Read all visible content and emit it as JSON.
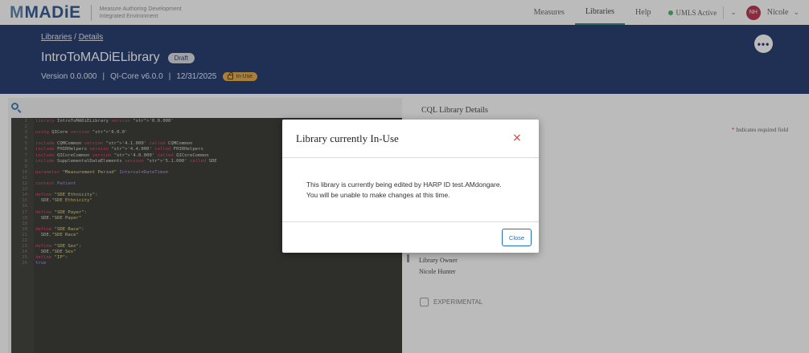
{
  "app": {
    "logo_mark": "M",
    "logo_text": "MADiE",
    "logo_sub_line1": "Measure Authoring Development",
    "logo_sub_line2": "Integrated Environment"
  },
  "nav": {
    "items": [
      "Measures",
      "Libraries",
      "Help"
    ],
    "active": "Libraries",
    "umls_status": "UMLS Active",
    "avatar_initials": "NH",
    "user_name": "Nicole"
  },
  "header": {
    "breadcrumb_root": "Libraries",
    "breadcrumb_separator": "/",
    "breadcrumb_current": "Details",
    "title": "IntroToMADiELibrary",
    "status_badge": "Draft",
    "version": "Version 0.0.000",
    "model": "QI-Core v6.0.0",
    "date": "12/31/2025",
    "meta_separator": "|",
    "in_use_badge": "In-Use",
    "more_button": "•••"
  },
  "editor": {
    "lines": [
      {
        "n": "1",
        "text": "library IntroToMADiELibrary version '0.0.000'"
      },
      {
        "n": "2",
        "text": ""
      },
      {
        "n": "3",
        "text": "using QICore version '6.0.0'"
      },
      {
        "n": "4",
        "text": ""
      },
      {
        "n": "5",
        "text": "include CQMCommon version '4.1.000' called CQMCommon"
      },
      {
        "n": "6",
        "text": "include FHIRHelpers version '4.4.000' called FHIRHelpers"
      },
      {
        "n": "7",
        "text": "include QICoreCommon version '4.0.000' called QICoreCommon"
      },
      {
        "n": "8",
        "text": "include SupplementalDataElements version '5.1.000' called SDE"
      },
      {
        "n": "9",
        "text": ""
      },
      {
        "n": "10",
        "text": "parameter \"Measurement Period\" Interval<DateTime>"
      },
      {
        "n": "11",
        "text": ""
      },
      {
        "n": "12",
        "text": "context Patient"
      },
      {
        "n": "13",
        "text": ""
      },
      {
        "n": "14",
        "text": "define \"SDE Ethnicity\":"
      },
      {
        "n": "15",
        "text": "  SDE.\"SDE Ethnicity\""
      },
      {
        "n": "16",
        "text": ""
      },
      {
        "n": "17",
        "text": "define \"SDE Payer\":"
      },
      {
        "n": "18",
        "text": "  SDE.\"SDE Payer\""
      },
      {
        "n": "19",
        "text": ""
      },
      {
        "n": "20",
        "text": "define \"SDE Race\":"
      },
      {
        "n": "21",
        "text": "  SDE.\"SDE Race\""
      },
      {
        "n": "22",
        "text": ""
      },
      {
        "n": "23",
        "text": "define \"SDE Sex\":"
      },
      {
        "n": "24",
        "text": "  SDE.\"SDE Sex\""
      },
      {
        "n": "25",
        "text": "define \"IP\":"
      },
      {
        "n": "26",
        "text": "true"
      }
    ]
  },
  "details": {
    "tab_label": "CQL Library Details",
    "required_asterisk": "*",
    "required_note": "Indicates required field",
    "owner_label": "Library Owner",
    "owner_value": "Nicole Hunter",
    "experimental_label": "EXPERIMENTAL"
  },
  "modal": {
    "title": "Library currently In-Use",
    "close_icon": "×",
    "message_line1": "This library is currently being edited by HARP ID test.AMdongare.",
    "message_line2": "You will be unable to make changes at this time.",
    "close_button": "Close"
  },
  "colors": {
    "header_bg": "#112a63",
    "accent_teal": "#2c7a7a",
    "in_use_badge": "#e2a43a",
    "close_red": "#d0413a",
    "button_blue": "#1f6fc0",
    "avatar": "#b5243f",
    "umls_dot": "#3fae5a"
  }
}
